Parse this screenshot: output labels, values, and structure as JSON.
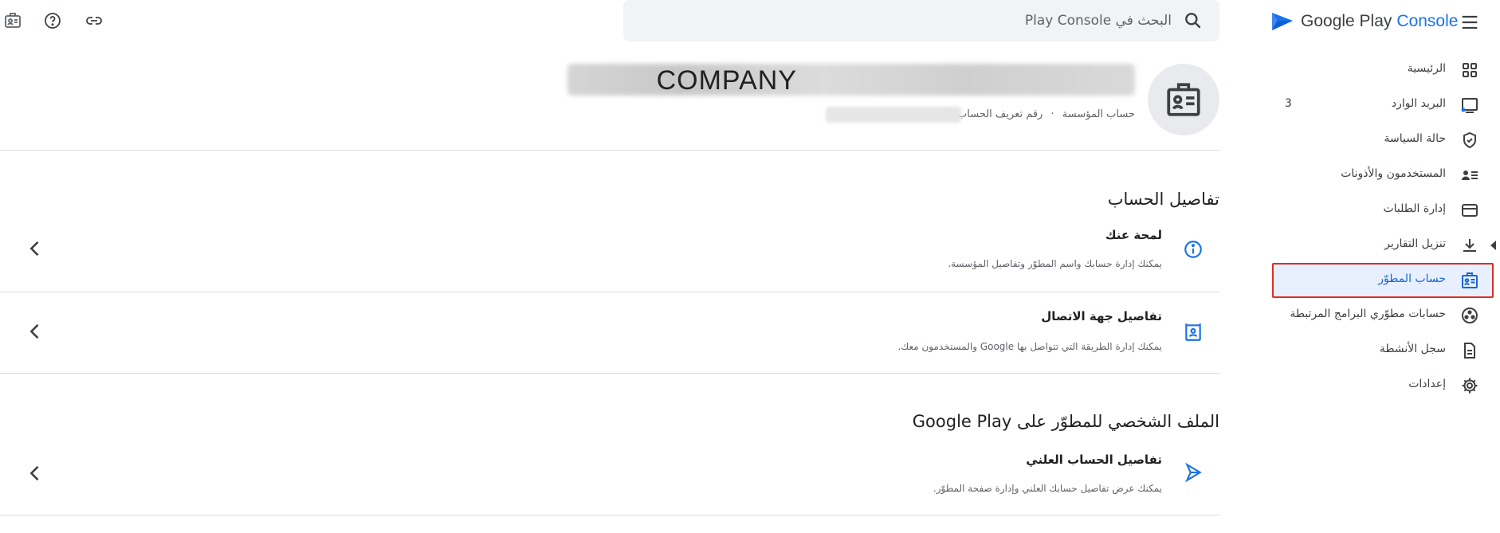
{
  "topbar": {
    "search_placeholder": "البحث في Play Console",
    "brand_name": "Google Play",
    "brand_suffix": "Console",
    "tool_icons": [
      "badge-icon",
      "help-icon",
      "link-icon"
    ]
  },
  "nav": {
    "items": [
      {
        "label": "الرئيسية",
        "icon": "grid-icon"
      },
      {
        "label": "البريد الوارد",
        "icon": "inbox-icon",
        "count": "3"
      },
      {
        "label": "حالة السياسة",
        "icon": "shield-check-icon"
      },
      {
        "label": "المستخدمون والأذونات",
        "icon": "people-list-icon"
      },
      {
        "label": "إدارة الطلبات",
        "icon": "credit-card-icon"
      },
      {
        "label": "تنزيل التقارير",
        "icon": "download-icon"
      },
      {
        "label": "حساب المطوّر",
        "icon": "badge-icon",
        "active": true
      },
      {
        "label": "حسابات مطوّري البرامج المرتبطة",
        "icon": "linked-accounts-icon"
      },
      {
        "label": "سجل الأنشطة",
        "icon": "document-icon"
      },
      {
        "label": "إعدادات",
        "icon": "gear-icon"
      }
    ]
  },
  "account": {
    "company": "COMPANY",
    "account_type": "حساب المؤسسة",
    "separator": "·",
    "account_id_label": "رقم تعريف الحساب: 8"
  },
  "sections": {
    "details_title": "تفاصيل الحساب",
    "profile_title": "الملف الشخصي للمطوّر على Google Play"
  },
  "rows": {
    "about": {
      "title": "لمحة عنك",
      "desc": "يمكنك إدارة حسابك واسم المطوّر وتفاصيل المؤسسة."
    },
    "contact": {
      "title": "تفاصيل جهة الاتصال",
      "desc": "يمكنك إدارة الطريقة التي تتواصل بها Google والمستخدمون معك."
    },
    "public": {
      "title": "تفاصيل الحساب العلني",
      "desc": "يمكنك عرض تفاصيل حسابك العلني وإدارة صفحة المطوّر."
    }
  },
  "colors": {
    "accent": "#1a73e8",
    "highlight_border": "#d93025",
    "active_bg": "#e8f0fe"
  }
}
